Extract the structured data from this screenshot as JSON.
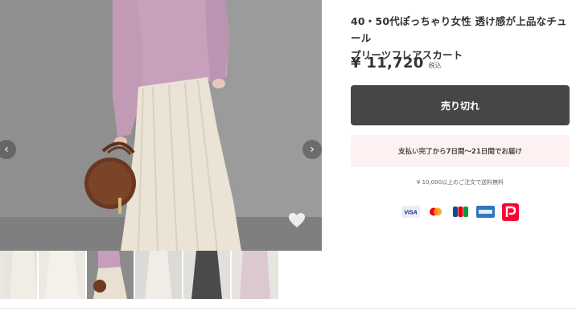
{
  "product": {
    "title_line1": "40・50代ぽっちゃり女性 透け感が上品なチュール",
    "title_line2": "プリーツフレアスカート",
    "price": "¥ 11,720",
    "tax_label": "税込"
  },
  "actions": {
    "soldout_label": "売り切れ"
  },
  "delivery": {
    "text": "支払い完了から7日間〜21日間でお届け"
  },
  "shipping": {
    "text": "¥ 10,000以上のご注文で送料無料"
  },
  "gallery": {
    "prev_icon": "chevron-left-icon",
    "next_icon": "chevron-right-icon",
    "favorite_icon": "heart-icon",
    "thumbnail_count": 6,
    "selected_thumbnail": 3
  },
  "payment_methods": [
    {
      "name": "VISA",
      "icon": "visa-icon",
      "color": "#1a1f71"
    },
    {
      "name": "Mastercard",
      "icon": "mastercard-icon",
      "color": "#eb001b"
    },
    {
      "name": "JCB",
      "icon": "jcb-icon",
      "color": "#0e4c96"
    },
    {
      "name": "AMERICAN EXPRESS",
      "icon": "amex-icon",
      "color": "#2e77bb"
    },
    {
      "name": "PayPay",
      "icon": "paypay-icon",
      "color": "#ff0033"
    }
  ],
  "colors": {
    "soldout_bg": "#464646",
    "delivery_bg": "#fdf1f1"
  }
}
